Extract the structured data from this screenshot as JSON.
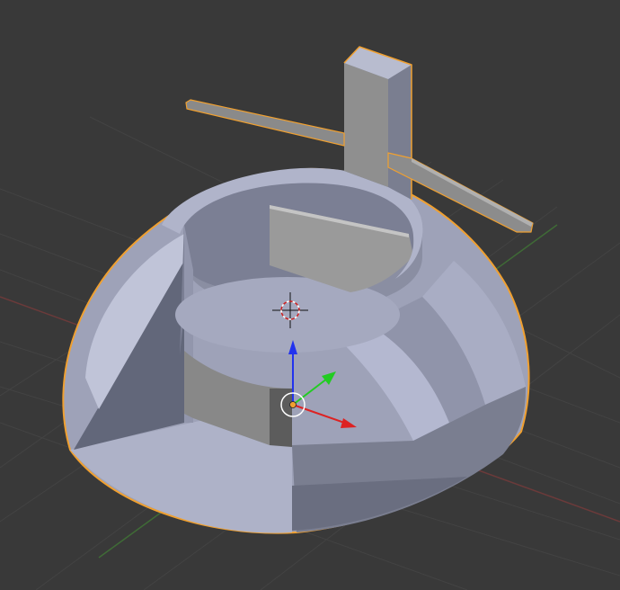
{
  "viewport": {
    "name": "3D Viewport",
    "background": "#393939",
    "grid_color": "#434343",
    "x_axis_line_color": "#6b3a3a",
    "y_axis_line_color": "#3f6b36"
  },
  "object": {
    "name": "selected-mesh",
    "outline_color": "#f0a030",
    "shade_light": "#b4b8d0",
    "shade_mid": "#8e92a6",
    "shade_dark": "#6a6e80",
    "shade_grey": "#9a9a9a"
  },
  "gizmo": {
    "x_color": "#dd2222",
    "y_color": "#22cc22",
    "z_color": "#2233ee",
    "origin_color": "#f0a030"
  },
  "cursor": {
    "color_primary": "#cc2222",
    "color_secondary": "#ffffff"
  }
}
